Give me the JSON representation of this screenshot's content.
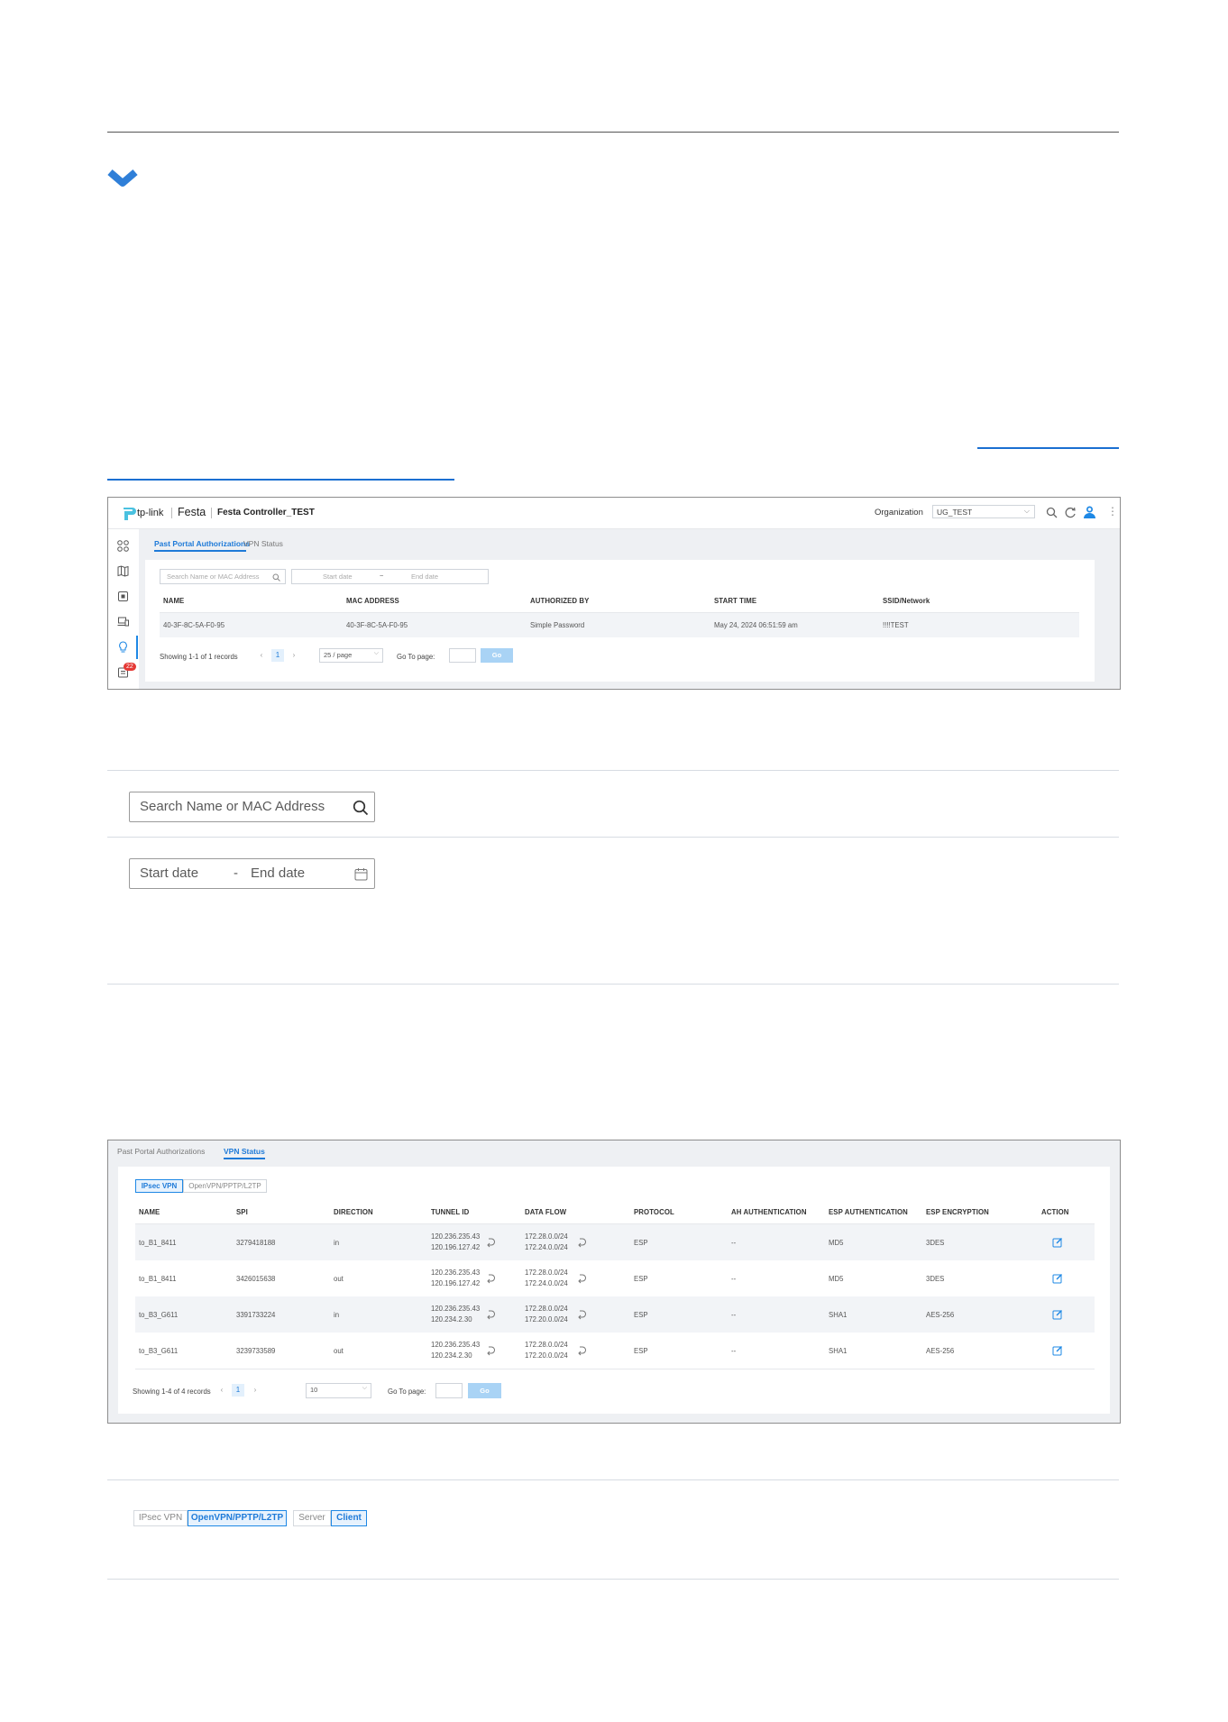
{
  "screenshot1": {
    "brand": "tp-link",
    "product": "Festa",
    "controller_name": "Festa Controller_TEST",
    "organization_label": "Organization",
    "organization_value": "UG_TEST",
    "notification_count": "22",
    "tabs": [
      "Past Portal Authorizations",
      "VPN Status"
    ],
    "search_placeholder": "Search Name or MAC Address",
    "start_date_placeholder": "Start date",
    "date_separator": "~",
    "end_date_placeholder": "End date",
    "columns": [
      "NAME",
      "MAC ADDRESS",
      "AUTHORIZED BY",
      "START TIME",
      "SSID/Network"
    ],
    "rows": [
      [
        "40-3F-8C-5A-F0-95",
        "40-3F-8C-5A-F0-95",
        "Simple Password",
        "May 24, 2024 06:51:59 am",
        "!!!!TEST"
      ]
    ],
    "showing": "Showing 1-1 of 1 records",
    "page": "1",
    "page_size": "25 / page",
    "goto_label": "Go To page:",
    "go_label": "Go"
  },
  "callouts": {
    "search_placeholder": "Search Name or MAC Address",
    "start_date": "Start date",
    "separator": "-",
    "end_date": "End date"
  },
  "screenshot2": {
    "tabs": [
      "Past Portal Authorizations",
      "VPN Status"
    ],
    "subtabs": [
      "IPsec VPN",
      "OpenVPN/PPTP/L2TP"
    ],
    "columns": [
      "NAME",
      "SPI",
      "DIRECTION",
      "TUNNEL ID",
      "DATA FLOW",
      "PROTOCOL",
      "AH AUTHENTICATION",
      "ESP AUTHENTICATION",
      "ESP ENCRYPTION",
      "ACTION"
    ],
    "rows": [
      {
        "name": "to_B1_8411",
        "spi": "3279418188",
        "direction": "in",
        "tunnel1": "120.236.235.43",
        "tunnel2": "120.196.127.42",
        "flow1": "172.28.0.0/24",
        "flow2": "172.24.0.0/24",
        "protocol": "ESP",
        "ah": "--",
        "esp_auth": "MD5",
        "esp_enc": "3DES"
      },
      {
        "name": "to_B1_8411",
        "spi": "3426015638",
        "direction": "out",
        "tunnel1": "120.236.235.43",
        "tunnel2": "120.196.127.42",
        "flow1": "172.28.0.0/24",
        "flow2": "172.24.0.0/24",
        "protocol": "ESP",
        "ah": "--",
        "esp_auth": "MD5",
        "esp_enc": "3DES"
      },
      {
        "name": "to_B3_G611",
        "spi": "3391733224",
        "direction": "in",
        "tunnel1": "120.236.235.43",
        "tunnel2": "120.234.2.30",
        "flow1": "172.28.0.0/24",
        "flow2": "172.20.0.0/24",
        "protocol": "ESP",
        "ah": "--",
        "esp_auth": "SHA1",
        "esp_enc": "AES-256"
      },
      {
        "name": "to_B3_G611",
        "spi": "3239733589",
        "direction": "out",
        "tunnel1": "120.236.235.43",
        "tunnel2": "120.234.2.30",
        "flow1": "172.28.0.0/24",
        "flow2": "172.20.0.0/24",
        "protocol": "ESP",
        "ah": "--",
        "esp_auth": "SHA1",
        "esp_enc": "AES-256"
      }
    ],
    "showing": "Showing 1-4 of 4 records",
    "page": "1",
    "page_size": "10",
    "goto_label": "Go To page:",
    "go_label": "Go"
  },
  "bottom_controls": {
    "type_tabs": [
      "IPsec VPN",
      "OpenVPN/PPTP/L2TP"
    ],
    "role_tabs": [
      "Server",
      "Client"
    ]
  },
  "colors": {
    "accent": "#1e7ad8",
    "chevron": "#2f7fd8",
    "badge": "#e53935"
  }
}
